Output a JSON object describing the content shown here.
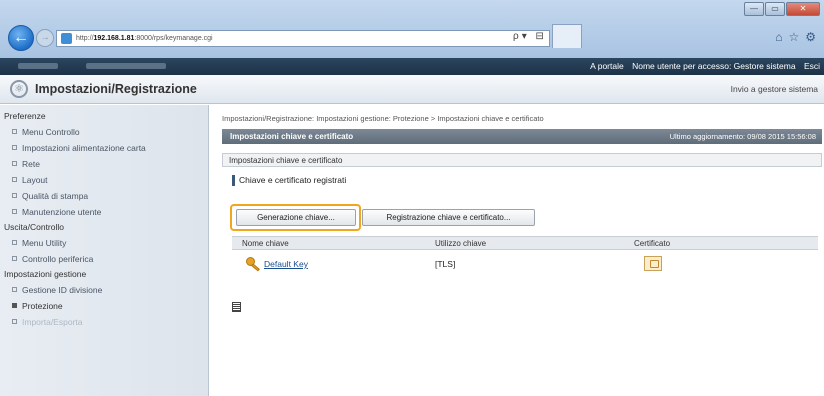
{
  "browser": {
    "url_prefix": "http://",
    "url_host": "192.168.1.81",
    "url_path": ":8000/rps/keymanage.cgi",
    "address_tools": "ρ▾ ⊟ ℭ ×",
    "window_controls": {
      "minimize": "—",
      "maximize": "▭",
      "close": "✕"
    },
    "icons": [
      "home-icon",
      "star-icon",
      "gear-icon"
    ]
  },
  "topbar": {
    "portal_link": "A portale",
    "user_label": "Nome utente per accesso: Gestore sistema",
    "logout": "Esci"
  },
  "header": {
    "title": "Impostazioni/Registrazione",
    "send_to_admin": "Invio a gestore sistema"
  },
  "sidebar": {
    "sections": [
      {
        "label": "Preferenze",
        "items": [
          {
            "label": "Menu Controllo"
          },
          {
            "label": "Impostazioni alimentazione carta"
          },
          {
            "label": "Rete"
          },
          {
            "label": "Layout"
          },
          {
            "label": "Qualità di stampa"
          },
          {
            "label": "Manutenzione utente"
          }
        ]
      },
      {
        "label": "Uscita/Controllo",
        "items": [
          {
            "label": "Menu Utility"
          },
          {
            "label": "Controllo periferica"
          }
        ]
      },
      {
        "label": "Impostazioni gestione",
        "items": [
          {
            "label": "Gestione ID divisione"
          },
          {
            "label": "Protezione"
          },
          {
            "label": "Importa/Esporta"
          }
        ]
      }
    ]
  },
  "main": {
    "breadcrumb": "Impostazioni/Registrazione: Impostazioni gestione: Protezione > Impostazioni chiave e certificato",
    "page_title": "Impostazioni chiave e certificato",
    "last_update": "Ultimo aggiornamento: 09/08 2015 15:56:08",
    "section_title": "Impostazioni chiave e certificato",
    "subheading": "Chiave e certificato registrati",
    "buttons": {
      "generate_key": "Generazione chiave...",
      "register_key": "Registrazione chiave e certificato..."
    },
    "table": {
      "columns": [
        "Nome chiave",
        "Utilizzo chiave",
        "Certificato"
      ],
      "rows": [
        {
          "name": "Default Key",
          "usage": "[TLS]"
        }
      ]
    }
  },
  "colors": {
    "highlight": "#f2a51f",
    "topbar": "#1c3247",
    "page_header": "#5f6c79"
  }
}
